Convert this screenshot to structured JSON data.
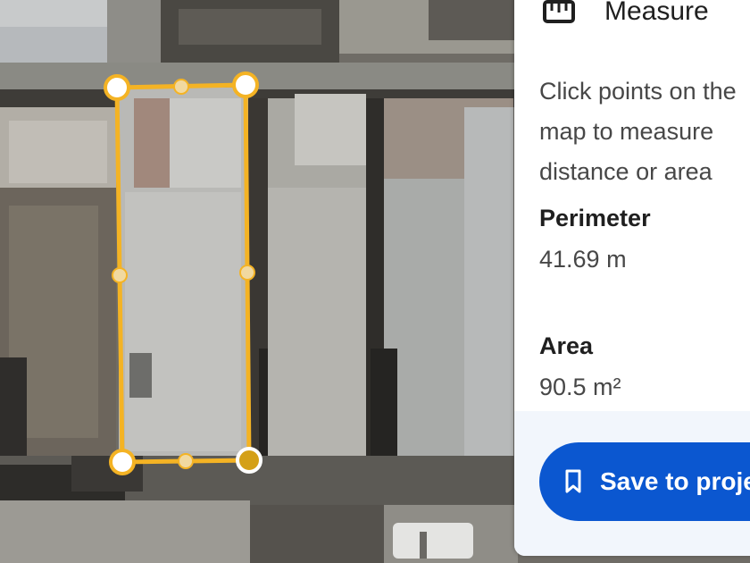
{
  "panel": {
    "title": "Measure",
    "icon": "ruler-icon",
    "instruction": "Click points on the map to measure distance or area",
    "perimeter": {
      "label": "Perimeter",
      "value": "41.69 m"
    },
    "area": {
      "label": "Area",
      "value": "90.5 m²"
    },
    "save_button": {
      "label": "Save to project",
      "icon": "bookmark-icon",
      "color": "#0b57d0"
    }
  },
  "measurement": {
    "shape": "polygon",
    "line_color": "#f4b324",
    "vertex_count": 4,
    "selected_vertex": 4
  }
}
